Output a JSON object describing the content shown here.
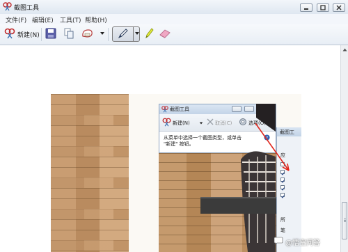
{
  "window": {
    "title": "截图工具"
  },
  "menu": {
    "items": [
      "文件(F)",
      "编辑(E)",
      "工具(T)",
      "帮助(H)"
    ]
  },
  "toolbar": {
    "new_label": "新建(N)"
  },
  "inner_window": {
    "title": "截图工具",
    "new_label": "新建(N)",
    "cancel_label": "取消(C)",
    "options_label": "选项(O)",
    "instruction_line1": "从菜单中选择一个截图类型，或单击",
    "instruction_line2": "\"新建\" 按钮。"
  },
  "options_dialog": {
    "title": "截图工",
    "section_label": "应",
    "bottom_label_1": "所",
    "bottom_label_2": "笔",
    "checkboxes": [
      false,
      true,
      true,
      true,
      true
    ]
  },
  "watermark": {
    "text": "@悟空问答"
  },
  "colors": {
    "accent_arrow": "#e0241b",
    "titlebar": "#dfe7f1",
    "wood": "#c99d72"
  },
  "icons": [
    "snipping-tool-icon",
    "save-icon",
    "copy-icon",
    "send-icon",
    "pen-icon",
    "highlighter-icon",
    "eraser-icon",
    "help-icon",
    "options-gear-icon"
  ]
}
